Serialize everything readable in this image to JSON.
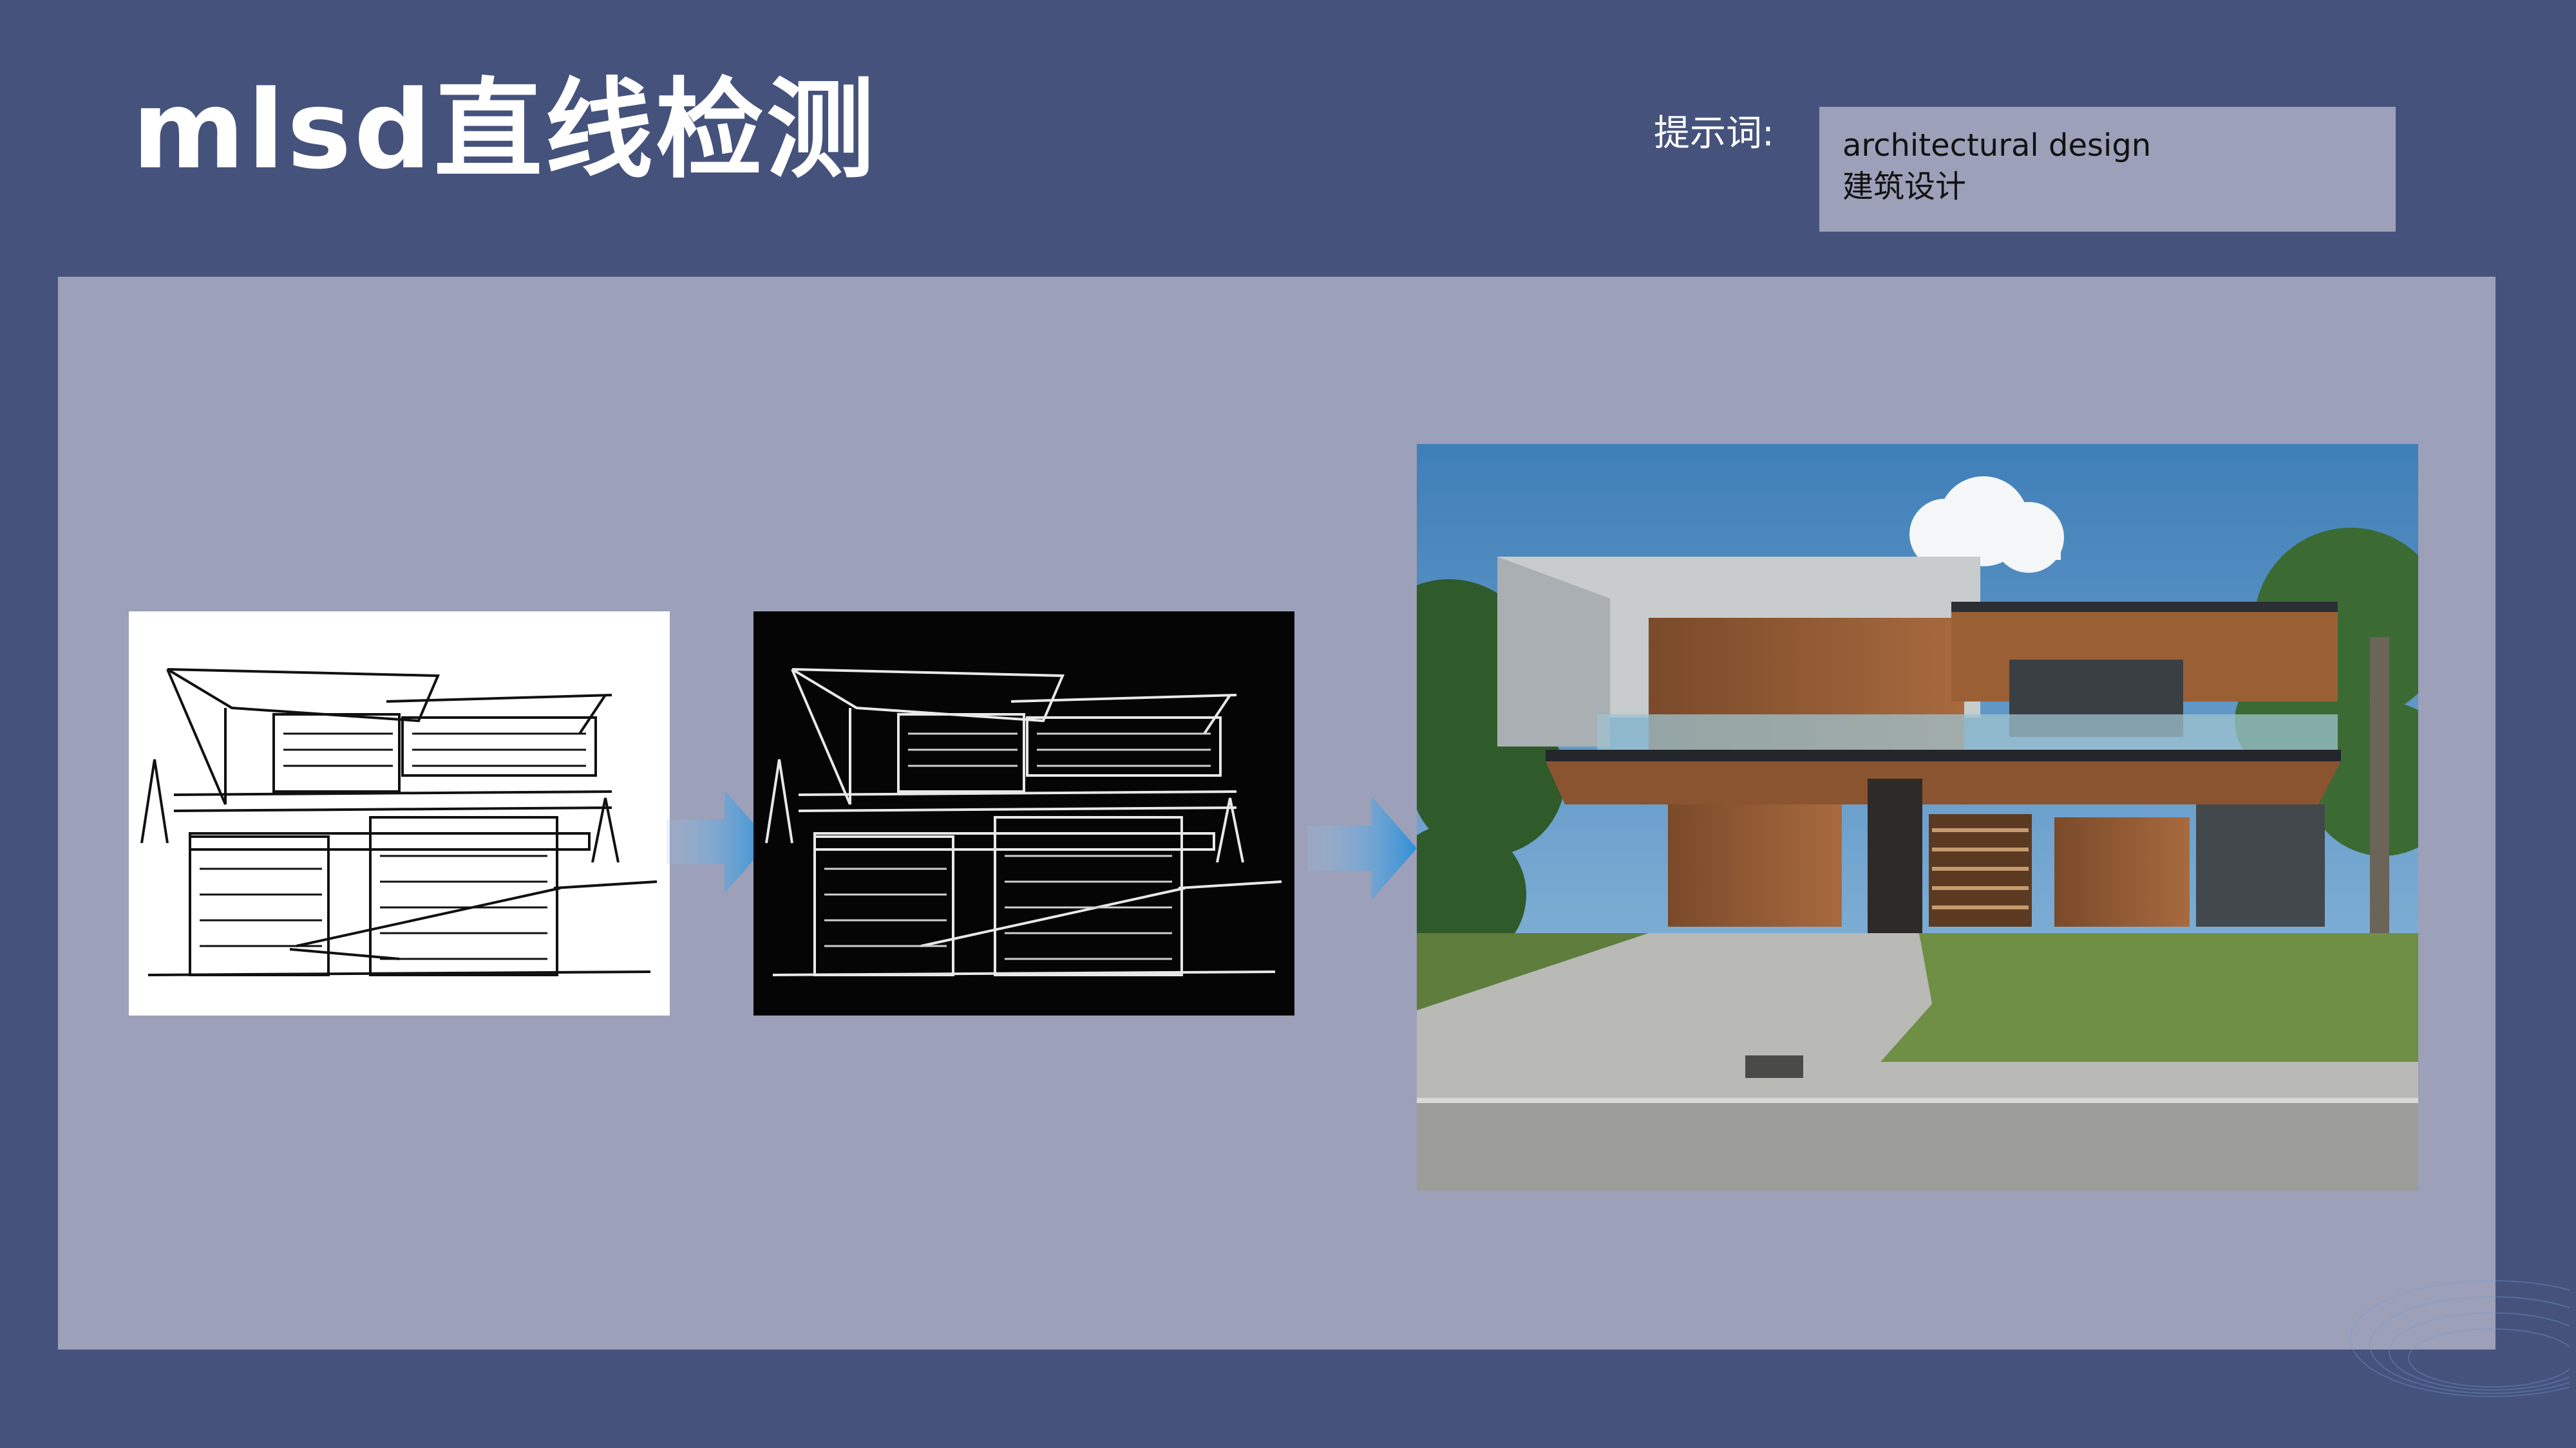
{
  "header": {
    "title": "mlsd直线检测",
    "prompt_label": "提示词:",
    "prompt_lines": [
      "architectural design",
      "建筑设计"
    ]
  },
  "panels": {
    "sketch": "line-sketch-image",
    "mlsd": "mlsd-line-map-image",
    "render": "rendered-house-photo"
  },
  "colors": {
    "background": "#45527c",
    "stage": "#9ca0b8",
    "arrow": "#2f8fd6"
  }
}
